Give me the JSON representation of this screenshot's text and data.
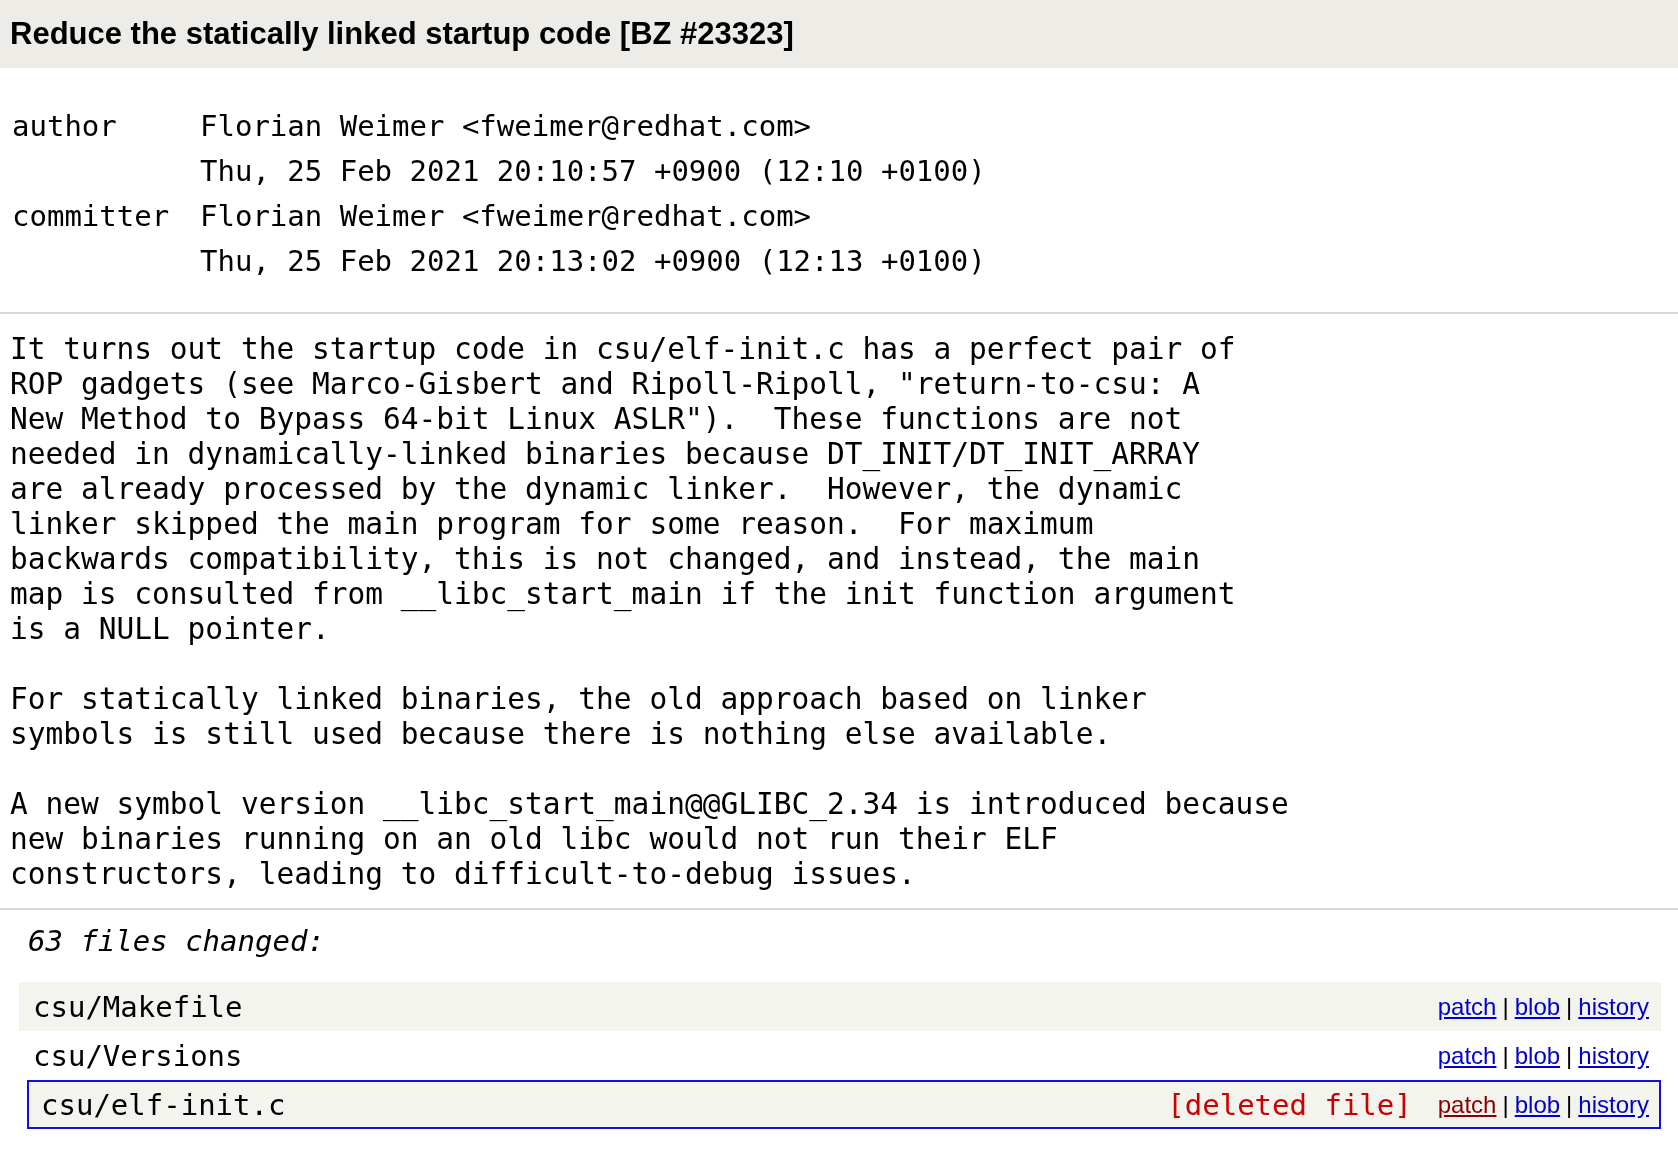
{
  "title": "Reduce the statically linked startup code [BZ #23323]",
  "people": [
    {
      "role": "author",
      "name": "Florian Weimer <fweimer@redhat.com>",
      "date": "Thu, 25 Feb 2021 20:10:57 +0900 (12:10 +0100)"
    },
    {
      "role": "committer",
      "name": "Florian Weimer <fweimer@redhat.com>",
      "date": "Thu, 25 Feb 2021 20:13:02 +0900 (12:13 +0100)"
    }
  ],
  "message": [
    "It turns out the startup code in csu/elf-init.c has a perfect pair of\nROP gadgets (see Marco-Gisbert and Ripoll-Ripoll, \"return-to-csu: A\nNew Method to Bypass 64-bit Linux ASLR\").  These functions are not\nneeded in dynamically-linked binaries because DT_INIT/DT_INIT_ARRAY\nare already processed by the dynamic linker.  However, the dynamic\nlinker skipped the main program for some reason.  For maximum\nbackwards compatibility, this is not changed, and instead, the main\nmap is consulted from __libc_start_main if the init function argument\nis a NULL pointer.",
    "For statically linked binaries, the old approach based on linker\nsymbols is still used because there is nothing else available.",
    "A new symbol version __libc_start_main@@GLIBC_2.34 is introduced because\nnew binaries running on an old libc would not run their ELF\nconstructors, leading to difficult-to-debug issues."
  ],
  "files_changed": "63 files changed:",
  "files": [
    {
      "path": "csu/Makefile",
      "selected": false,
      "links": [
        {
          "label": "patch",
          "visited": false
        },
        {
          "label": "|",
          "kind": "sep"
        },
        {
          "label": "blob",
          "visited": false
        },
        {
          "label": "|",
          "kind": "sep"
        },
        {
          "label": "history",
          "visited": false
        }
      ]
    },
    {
      "path": "csu/Versions",
      "selected": false,
      "links": [
        {
          "label": "patch",
          "visited": false
        },
        {
          "label": "|",
          "kind": "sep"
        },
        {
          "label": "blob",
          "visited": false
        },
        {
          "label": "|",
          "kind": "sep"
        },
        {
          "label": "history",
          "visited": false
        }
      ]
    },
    {
      "path": "csu/elf-init.c",
      "status": "[deleted file]",
      "selected": true,
      "links": [
        {
          "label": "patch",
          "visited": true
        },
        {
          "label": "|",
          "kind": "sep"
        },
        {
          "label": "blob",
          "visited": false
        },
        {
          "label": "|",
          "kind": "sep"
        },
        {
          "label": "history",
          "visited": false
        }
      ]
    }
  ]
}
